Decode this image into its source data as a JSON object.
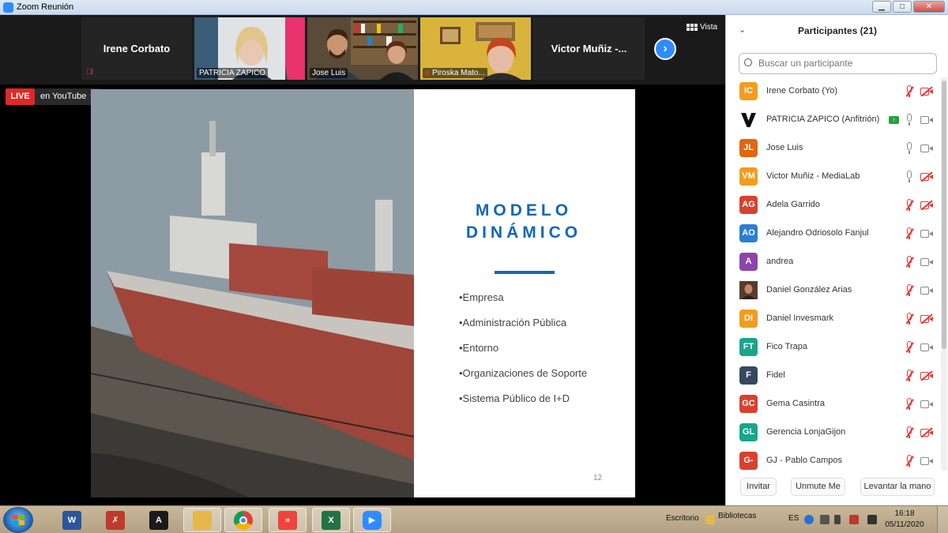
{
  "window": {
    "title": "Zoom Reunión",
    "minimize": "▁",
    "maximize": "□",
    "close": "✕"
  },
  "gallery": {
    "tiles": [
      {
        "name": "Irene Corbato"
      },
      {
        "name": "PATRICIA ZAPICO"
      },
      {
        "name": "Jose Luis"
      },
      {
        "name": "Piroska Mato..."
      },
      {
        "name": "Victor Muñiz -..."
      }
    ],
    "view_label": "Vista",
    "next_label": "›"
  },
  "stream": {
    "live": "LIVE",
    "destination": "en YouTube"
  },
  "slide": {
    "title_line1": "MODELO",
    "title_line2": "DINÁMICO",
    "bullets": [
      "•Empresa",
      "•Administración Pública",
      "•Entorno",
      "•Organizaciones de Soporte",
      "•Sistema Público de I+D"
    ],
    "page_number": "12"
  },
  "participants": {
    "title": "Participantes (21)",
    "search_placeholder": "Buscar un participante",
    "list": [
      {
        "initials": "IC",
        "name": "Irene Corbato (Yo)",
        "color": "#f39c1e",
        "mic": "muted",
        "cam": "off"
      },
      {
        "initials": "",
        "name": "PATRICIA ZAPICO (Anfitrión)",
        "color": "#ffffff",
        "mic": "on",
        "cam": "on",
        "sharing": true
      },
      {
        "initials": "JL",
        "name": "Jose Luis",
        "color": "#e0660f",
        "mic": "on",
        "cam": "on"
      },
      {
        "initials": "VM",
        "name": "Victor Muñiz -  MediaLab",
        "color": "#f39c1e",
        "mic": "on",
        "cam": "off"
      },
      {
        "initials": "AG",
        "name": "Adela Garrido",
        "color": "#d9412f",
        "mic": "muted",
        "cam": "off"
      },
      {
        "initials": "AO",
        "name": "Alejandro Odriosolo Fanjul",
        "color": "#2a7ed6",
        "mic": "muted",
        "cam": "on"
      },
      {
        "initials": "A",
        "name": "andrea",
        "color": "#8e44ad",
        "mic": "muted",
        "cam": "on"
      },
      {
        "initials": "",
        "name": "Daniel González Arias",
        "color": "#5a3b2a",
        "mic": "muted",
        "cam": "on"
      },
      {
        "initials": "DI",
        "name": "Daniel Invesmark",
        "color": "#f39c1e",
        "mic": "muted",
        "cam": "off"
      },
      {
        "initials": "FT",
        "name": "Fico Trapa",
        "color": "#19a58a",
        "mic": "muted",
        "cam": "on"
      },
      {
        "initials": "F",
        "name": "Fidel",
        "color": "#34495e",
        "mic": "muted",
        "cam": "off"
      },
      {
        "initials": "GC",
        "name": "Gema Casintra",
        "color": "#d9412f",
        "mic": "muted",
        "cam": "on"
      },
      {
        "initials": "GL",
        "name": "Gerencia LonjaGijon",
        "color": "#19a58a",
        "mic": "muted",
        "cam": "off"
      },
      {
        "initials": "G-",
        "name": "GJ - Pablo Campos",
        "color": "#d9412f",
        "mic": "muted",
        "cam": "on"
      }
    ],
    "buttons": {
      "invite": "Invitar",
      "unmute": "Unmute Me",
      "raise_hand": "Levantar la mano"
    }
  },
  "taskbar": {
    "apps": [
      {
        "icon": "word-icon",
        "label": "W",
        "color": "#2b579a"
      },
      {
        "icon": "pdf-tool-icon",
        "label": "✗",
        "color": "#c0392b"
      },
      {
        "icon": "acrobat-icon",
        "label": "A",
        "color": "#1a1a1a"
      },
      {
        "icon": "folder-icon",
        "label": "",
        "color": "#e5b84a"
      },
      {
        "icon": "chrome-icon",
        "label": "",
        "color": "#db4437"
      },
      {
        "icon": "anydesk-icon",
        "label": "»",
        "color": "#ef443b"
      },
      {
        "icon": "excel-icon",
        "label": "X",
        "color": "#217346"
      },
      {
        "icon": "zoom-icon",
        "label": "▶",
        "color": "#2d8cff"
      }
    ],
    "desktop_label": "Escritorio",
    "libraries_label": "Bibliotecas",
    "language": "ES",
    "time": "16:18",
    "date": "05/11/2020"
  }
}
